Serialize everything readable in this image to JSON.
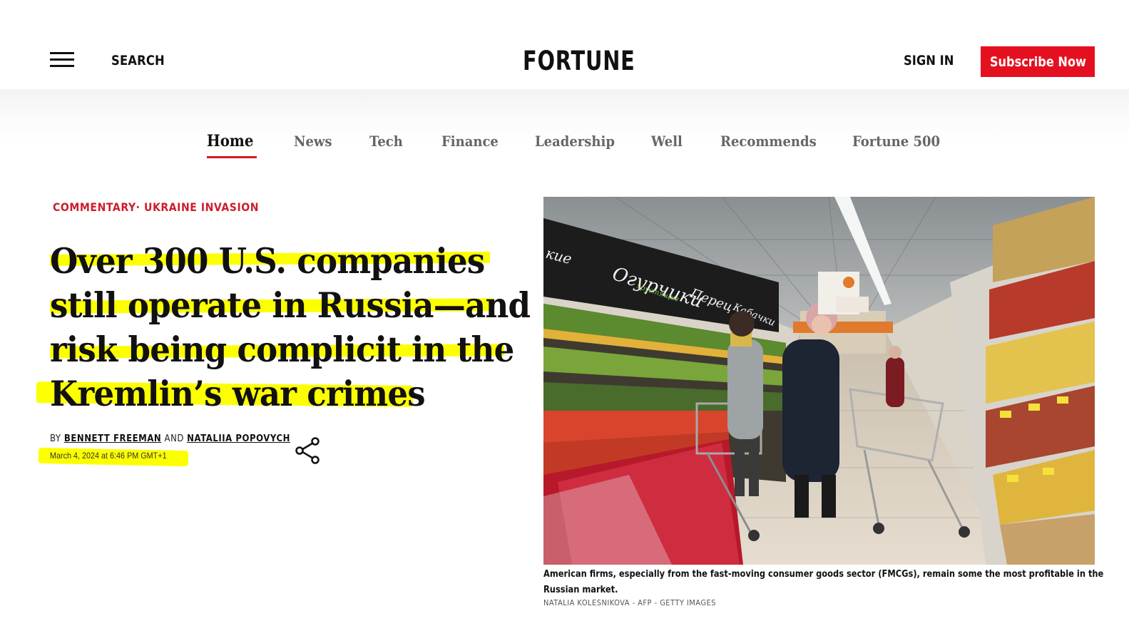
{
  "header": {
    "search_label": "SEARCH",
    "logo_text": "FORTUNE",
    "signin_label": "SIGN IN",
    "subscribe_label": "Subscribe Now",
    "subscribe_color": "#e5101f"
  },
  "nav": {
    "items": [
      {
        "label": "Home",
        "active": true
      },
      {
        "label": "News"
      },
      {
        "label": "Tech"
      },
      {
        "label": "Finance"
      },
      {
        "label": "Leadership"
      },
      {
        "label": "Well"
      },
      {
        "label": "Recommends"
      },
      {
        "label": "Fortune 500"
      }
    ],
    "active_color": "#d71921"
  },
  "article": {
    "kicker": "COMMENTARY· UKRAINE INVASION",
    "kicker_color": "#cc1e2c",
    "headline_lines": [
      "Over 300 U.S. companies",
      "still operate in Russia—and",
      "risk being complicit in the",
      "Kremlin’s war crimes"
    ],
    "highlight_color": "#fcff00",
    "byline": {
      "by": "BY",
      "author1": "BENNETT FREEMAN",
      "and": "AND",
      "author2": "NATALIIA POPOVYCH"
    },
    "date": "March 4, 2024 at 6:46 PM GMT+1",
    "share_icon": "share-icon"
  },
  "hero": {
    "caption": [
      "American firms, especially from the fast-moving consumer goods sector (FMCGs), remain some the most profitable in the",
      "Russian market."
    ],
    "credit": "NATALIA KOLESNIKOVA - AFP - GETTY IMAGES",
    "signs": {
      "sign1": "Огурчики",
      "sign1_sub": "хрустящие",
      "sign2": "Перец",
      "sign3": "Кабачки",
      "sign0": "кие"
    }
  }
}
